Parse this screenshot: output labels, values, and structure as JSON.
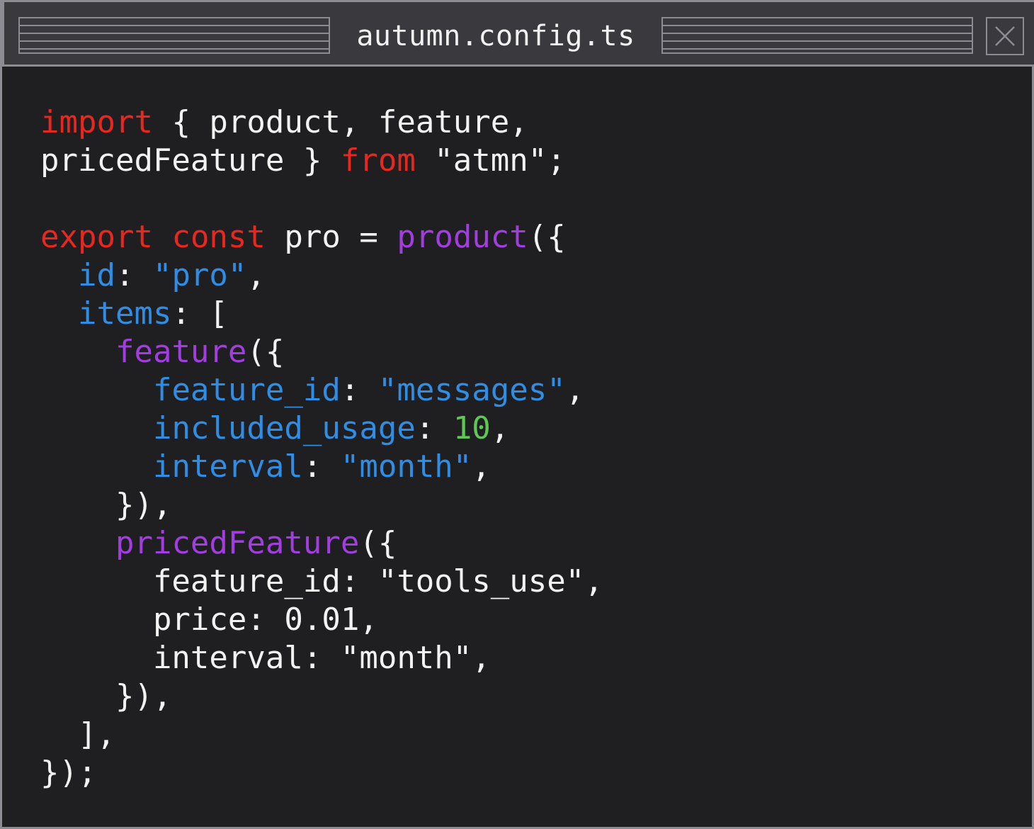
{
  "window": {
    "title": "autumn.config.ts"
  },
  "colors": {
    "background": "#1f1e21",
    "titlebar": "#3a393d",
    "border": "#8e8c93",
    "keyword": "#e8271f",
    "function": "#a23ee0",
    "property": "#2f8de4",
    "number": "#5fc754",
    "text": "#f2f2f2"
  },
  "icons": {
    "close": "close-icon"
  },
  "code": {
    "lines": [
      [
        {
          "t": "import",
          "c": "kw"
        },
        {
          "t": " { product, feature,",
          "c": "plain"
        }
      ],
      [
        {
          "t": "pricedFeature } ",
          "c": "plain"
        },
        {
          "t": "from",
          "c": "kw"
        },
        {
          "t": " \"atmn\";",
          "c": "plain"
        }
      ],
      [],
      [
        {
          "t": "export",
          "c": "kw"
        },
        {
          "t": " ",
          "c": "plain"
        },
        {
          "t": "const",
          "c": "kw"
        },
        {
          "t": " pro = ",
          "c": "plain"
        },
        {
          "t": "product",
          "c": "fn"
        },
        {
          "t": "({",
          "c": "plain"
        }
      ],
      [
        {
          "t": "  ",
          "c": "plain"
        },
        {
          "t": "id",
          "c": "key"
        },
        {
          "t": ": ",
          "c": "plain"
        },
        {
          "t": "\"pro\"",
          "c": "str"
        },
        {
          "t": ",",
          "c": "plain"
        }
      ],
      [
        {
          "t": "  ",
          "c": "plain"
        },
        {
          "t": "items",
          "c": "key"
        },
        {
          "t": ": [",
          "c": "plain"
        }
      ],
      [
        {
          "t": "    ",
          "c": "plain"
        },
        {
          "t": "feature",
          "c": "fn"
        },
        {
          "t": "({",
          "c": "plain"
        }
      ],
      [
        {
          "t": "      ",
          "c": "plain"
        },
        {
          "t": "feature_id",
          "c": "key"
        },
        {
          "t": ": ",
          "c": "plain"
        },
        {
          "t": "\"messages\"",
          "c": "str"
        },
        {
          "t": ",",
          "c": "plain"
        }
      ],
      [
        {
          "t": "      ",
          "c": "plain"
        },
        {
          "t": "included_usage",
          "c": "key"
        },
        {
          "t": ": ",
          "c": "plain"
        },
        {
          "t": "10",
          "c": "num"
        },
        {
          "t": ",",
          "c": "plain"
        }
      ],
      [
        {
          "t": "      ",
          "c": "plain"
        },
        {
          "t": "interval",
          "c": "key"
        },
        {
          "t": ": ",
          "c": "plain"
        },
        {
          "t": "\"month\"",
          "c": "str"
        },
        {
          "t": ",",
          "c": "plain"
        }
      ],
      [
        {
          "t": "    }),",
          "c": "plain"
        }
      ],
      [
        {
          "t": "    ",
          "c": "plain"
        },
        {
          "t": "pricedFeature",
          "c": "fn"
        },
        {
          "t": "({",
          "c": "plain"
        }
      ],
      [
        {
          "t": "      feature_id: \"tools_use\",",
          "c": "plain"
        }
      ],
      [
        {
          "t": "      price: 0.01,",
          "c": "plain"
        }
      ],
      [
        {
          "t": "      interval: \"month\",",
          "c": "plain"
        }
      ],
      [
        {
          "t": "    }),",
          "c": "plain"
        }
      ],
      [
        {
          "t": "  ],",
          "c": "plain"
        }
      ],
      [
        {
          "t": "});",
          "c": "plain"
        }
      ]
    ]
  }
}
